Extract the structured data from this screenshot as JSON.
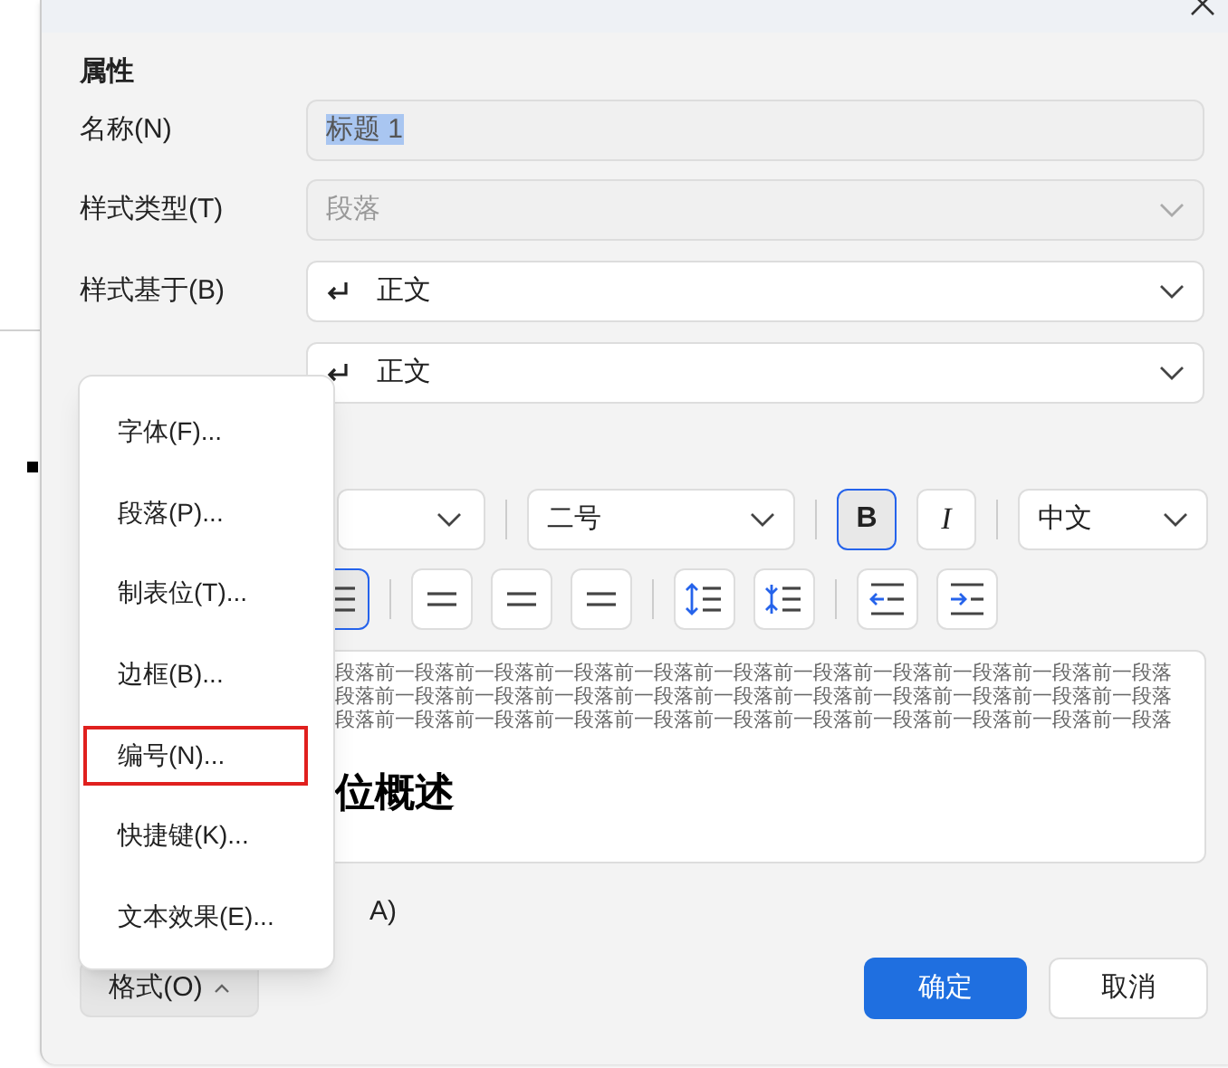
{
  "section_title": "属性",
  "fields": [
    {
      "label": "名称(N)",
      "kind": "text",
      "value": "标题 1",
      "disabled": true,
      "highlighted": true
    },
    {
      "label": "样式类型(T)",
      "kind": "select",
      "value": "段落",
      "disabled": true
    },
    {
      "label": "样式基于(B)",
      "kind": "select",
      "value": "正文",
      "disabled": false,
      "icon": true
    },
    {
      "kind": "select",
      "value": "正文",
      "disabled": false,
      "icon": true
    }
  ],
  "format_toolbar": {
    "font_size": "二号",
    "bold": {
      "label": "B",
      "selected": true
    },
    "italic": {
      "label": "I",
      "selected": false
    },
    "language": "中文"
  },
  "paragraph_buttons": [
    {
      "kind": "justify",
      "selected": true
    },
    {
      "kind": "center",
      "selected": false
    },
    {
      "kind": "center",
      "selected": false
    },
    {
      "kind": "right",
      "selected": false
    },
    {
      "kind": "spacing-up",
      "selected": false
    },
    {
      "kind": "spacing-down",
      "selected": false
    },
    {
      "kind": "outdent",
      "selected": false
    },
    {
      "kind": "indent",
      "selected": false
    }
  ],
  "preview": {
    "lines": [
      "段落前一段落前一段落前一段落前一段落前一段落前一段落前一段落前一段落前一段落前一段落",
      "段落前一段落前一段落前一段落前一段落前一段落前一段落前一段落前一段落前一段落前一段落",
      "段落前一段落前一段落前一段落前一段落前一段落前一段落前一段落前一段落前一段落前一段落"
    ],
    "heading": "位概述"
  },
  "option_label": "A)",
  "format_menu": [
    {
      "label": "字体(F)...",
      "selected": false
    },
    {
      "label": "段落(P)...",
      "selected": false
    },
    {
      "label": "制表位(T)...",
      "selected": false
    },
    {
      "label": "边框(B)...",
      "selected": false
    },
    {
      "label": "编号(N)...",
      "selected": true
    },
    {
      "label": "快捷键(K)...",
      "selected": false
    },
    {
      "label": "文本效果(E)...",
      "selected": false
    }
  ],
  "format_button": "格式(O)",
  "buttons": [
    {
      "label": "确定",
      "kind": "primary"
    },
    {
      "label": "取消",
      "kind": "secondary"
    }
  ]
}
